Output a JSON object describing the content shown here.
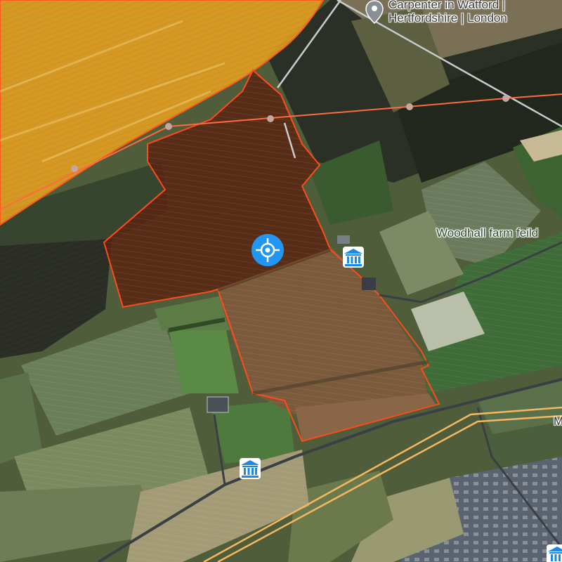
{
  "map": {
    "type": "satellite",
    "poi": {
      "name": "Carpenter in Watford | Hertfordshire | London",
      "line1": "Carpenter in Watford |",
      "line2": "Hertfordshire | London",
      "icon": "map-pin-icon"
    },
    "area_label": "Woodhall farm feild",
    "edge_label": "M",
    "markers": [
      {
        "kind": "current-location",
        "icon": "crosshair-icon",
        "color": "#2196f3"
      },
      {
        "kind": "museum",
        "icon": "museum-icon",
        "color": "#1e88e5"
      },
      {
        "kind": "museum",
        "icon": "museum-icon",
        "color": "#1e88e5"
      },
      {
        "kind": "museum",
        "icon": "museum-icon",
        "color": "#1e88e5"
      }
    ],
    "overlays": {
      "selected_field": {
        "fill": "#5a2210",
        "stroke": "#ff4a1c"
      },
      "orange_region": {
        "fill": "#e8a020",
        "stroke": "#ff5a1c"
      },
      "power_line_color": "#ff6a40",
      "path_line_color": "#c8ccd0",
      "road_color": "#f4b860"
    }
  }
}
